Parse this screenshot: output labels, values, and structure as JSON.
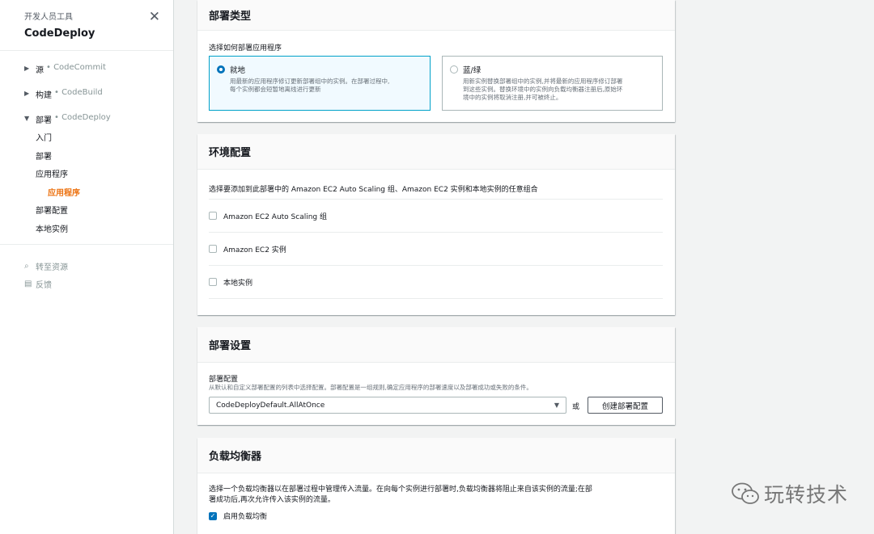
{
  "sidebar": {
    "subtitle": "开发人员工具",
    "title": "CodeDeploy",
    "close_icon": "close-icon",
    "groups": [
      {
        "label": "源",
        "service": "• CodeCommit",
        "expanded": false
      },
      {
        "label": "构建",
        "service": "• CodeBuild",
        "expanded": false
      },
      {
        "label": "部署",
        "service": "• CodeDeploy",
        "expanded": true
      }
    ],
    "deploy_items": [
      "入门",
      "部署",
      "应用程序"
    ],
    "deploy_active": "应用程序",
    "deploy_items2": [
      "部署配置",
      "本地实例"
    ],
    "utils": [
      {
        "icon": "search-icon",
        "label": "转至资源"
      },
      {
        "icon": "feedback-icon",
        "label": "反馈"
      }
    ]
  },
  "deploy_type": {
    "heading": "部署类型",
    "prompt": "选择如何部署应用程序",
    "inplace_title": "就地",
    "inplace_desc1": "用最新的应用程序修订更新部署组中的实例。在部署过程中,",
    "inplace_desc2": "每个实例都会短暂地离线进行更新",
    "bluegreen_title": "蓝/绿",
    "bluegreen_desc1": "用新实例替换部署组中的实例,并将最新的应用程序修订部署",
    "bluegreen_desc2": "到这些实例。替换环境中的实例向负载均衡器注册后,原始环",
    "bluegreen_desc3": "境中的实例将取消注册,并可被终止。",
    "selected": "inplace"
  },
  "environment": {
    "heading": "环境配置",
    "prompt": "选择要添加到此部署中的 Amazon EC2 Auto Scaling 组、Amazon EC2 实例和本地实例的任意组合",
    "options": [
      "Amazon EC2 Auto Scaling 组",
      "Amazon EC2 实例",
      "本地实例"
    ]
  },
  "deploy_settings": {
    "heading": "部署设置",
    "config_label": "部署配置",
    "config_desc": "从默认和自定义部署配置的列表中选择配置。部署配置是一组规则,确定应用程序的部署速度以及部署成功或失败的条件。",
    "selected_value": "CodeDeployDefault.AllAtOnce",
    "or_text": "或",
    "create_button": "创建部署配置"
  },
  "load_balancer": {
    "heading": "负载均衡器",
    "desc1": "选择一个负载均衡器以在部署过程中管理传入流量。在向每个实例进行部署时,负载均衡器将阻止来自该实例的流量;在部",
    "desc2": "署成功后,再次允许传入该实例的流量。",
    "enable_label": "启用负载均衡",
    "enabled": true
  },
  "watermark": {
    "text": "玩转技术",
    "icon": "wechat-icon"
  }
}
